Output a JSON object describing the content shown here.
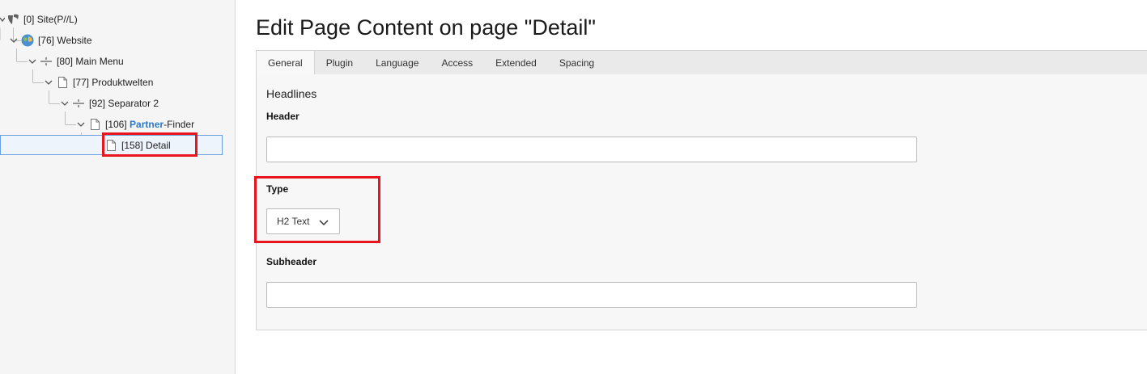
{
  "tree": {
    "nodes": [
      {
        "id": "[0]",
        "label": "Site(P//L)"
      },
      {
        "id": "[76]",
        "label": "Website"
      },
      {
        "id": "[80]",
        "label": "Main Menu"
      },
      {
        "id": "[77]",
        "label": "Produktwelten"
      },
      {
        "id": "[92]",
        "label": "Separator 2"
      },
      {
        "id": "[106]",
        "label_highlight": "Partner",
        "label_rest": "-Finder"
      },
      {
        "id": "[158]",
        "label": "Detail"
      }
    ]
  },
  "main": {
    "title": "Edit Page Content on page \"Detail\"",
    "tabs": [
      {
        "label": "General"
      },
      {
        "label": "Plugin"
      },
      {
        "label": "Language"
      },
      {
        "label": "Access"
      },
      {
        "label": "Extended"
      },
      {
        "label": "Spacing"
      }
    ],
    "section_title": "Headlines",
    "fields": {
      "header": {
        "label": "Header",
        "value": ""
      },
      "type": {
        "label": "Type",
        "value": "H2 Text"
      },
      "subheader": {
        "label": "Subheader",
        "value": ""
      }
    }
  },
  "colors": {
    "annotation": "#e8151e",
    "highlight_text": "#2b7ac8",
    "selection_border": "#6aa0dd"
  }
}
